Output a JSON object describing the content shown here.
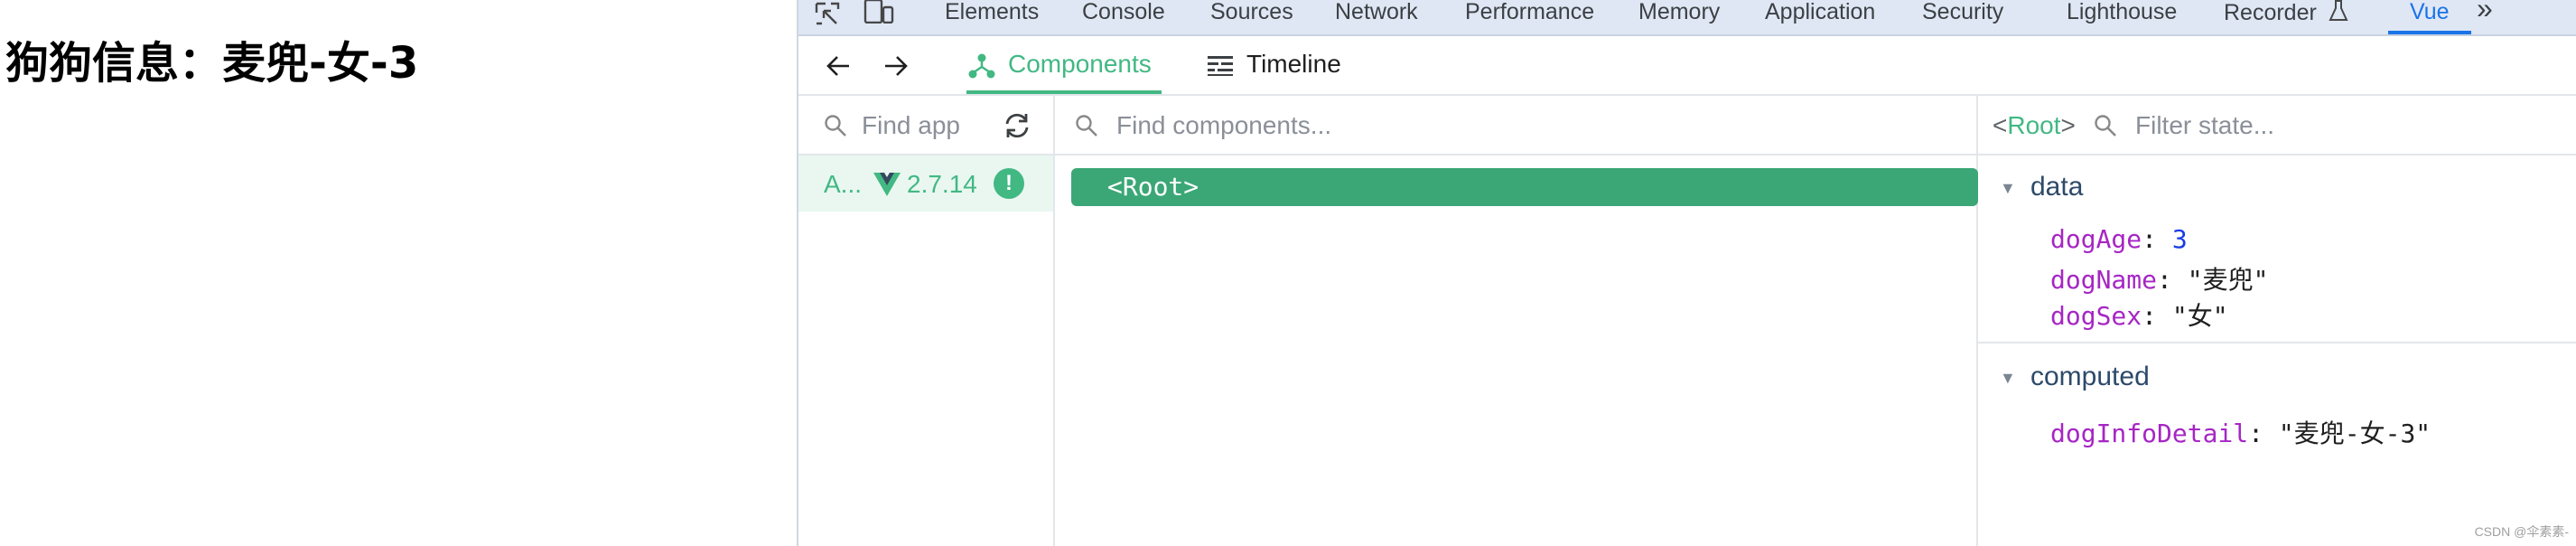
{
  "page": {
    "title": "狗狗信息：麦兜-女-3"
  },
  "devtools": {
    "tabs": [
      {
        "label": "Elements"
      },
      {
        "label": "Console"
      },
      {
        "label": "Sources"
      },
      {
        "label": "Network"
      },
      {
        "label": "Performance"
      },
      {
        "label": "Memory"
      },
      {
        "label": "Application"
      },
      {
        "label": "Security"
      },
      {
        "label": "Lighthouse"
      },
      {
        "label": "Recorder"
      },
      {
        "label": "Vue"
      }
    ],
    "more_label": "»",
    "recorder_icon": "flask-icon",
    "accent_color": "#1a73e8"
  },
  "vue": {
    "accent_color": "#42b883",
    "tabs": [
      {
        "label": "Components"
      },
      {
        "label": "Timeline"
      }
    ],
    "apps": {
      "search_placeholder": "Find app",
      "selected_app_name": "A...",
      "version": "2.7.14",
      "badge": "!"
    },
    "tree": {
      "search_placeholder": "Find components...",
      "root_label": "<Root>"
    },
    "state": {
      "component_prefix": "<",
      "component_name": "Root",
      "component_suffix": ">",
      "filter_placeholder": "Filter state...",
      "sections": [
        {
          "title": "data",
          "props": [
            {
              "key": "dogAge",
              "value": "3"
            },
            {
              "key": "dogName",
              "value": "\"麦兜\""
            },
            {
              "key": "dogSex",
              "value": "\"女\""
            }
          ]
        },
        {
          "title": "computed",
          "props": [
            {
              "key": "dogInfoDetail",
              "value": "\"麦兜-女-3\""
            }
          ]
        }
      ]
    }
  },
  "watermark": "CSDN @伞素素-"
}
